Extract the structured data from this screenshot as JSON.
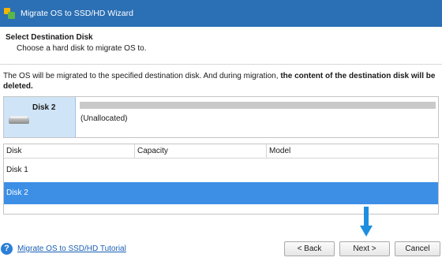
{
  "window": {
    "title": "Migrate OS to SSD/HD Wizard"
  },
  "header": {
    "title": "Select Destination Disk",
    "subtitle": "Choose a hard disk to migrate OS to."
  },
  "notice": {
    "text_normal": "The OS will be migrated to the specified destination disk. And during migration, ",
    "text_bold": "the content of the destination disk will be deleted."
  },
  "disk_preview": {
    "name": "Disk 2",
    "partition_label": "(Unallocated)"
  },
  "table": {
    "columns": [
      "Disk",
      "Capacity",
      "Model"
    ],
    "rows": [
      {
        "disk": "Disk 1",
        "capacity": "",
        "model": "",
        "selected": false
      },
      {
        "disk": "Disk 2",
        "capacity": "",
        "model": "",
        "selected": true
      }
    ]
  },
  "footer": {
    "tutorial_link": "Migrate OS to SSD/HD Tutorial",
    "back_label": "< Back",
    "next_label": "Next >",
    "cancel_label": "Cancel"
  },
  "icons": {
    "app": "minitool-icon",
    "disk": "hard-disk-icon",
    "help": "question-icon",
    "arrow": "down-arrow-icon"
  },
  "colors": {
    "titlebar": "#2b6fb4",
    "selected_row": "#3d8fe6",
    "disk_panel": "#cfe4f7",
    "arrow": "#1e8fe0"
  }
}
